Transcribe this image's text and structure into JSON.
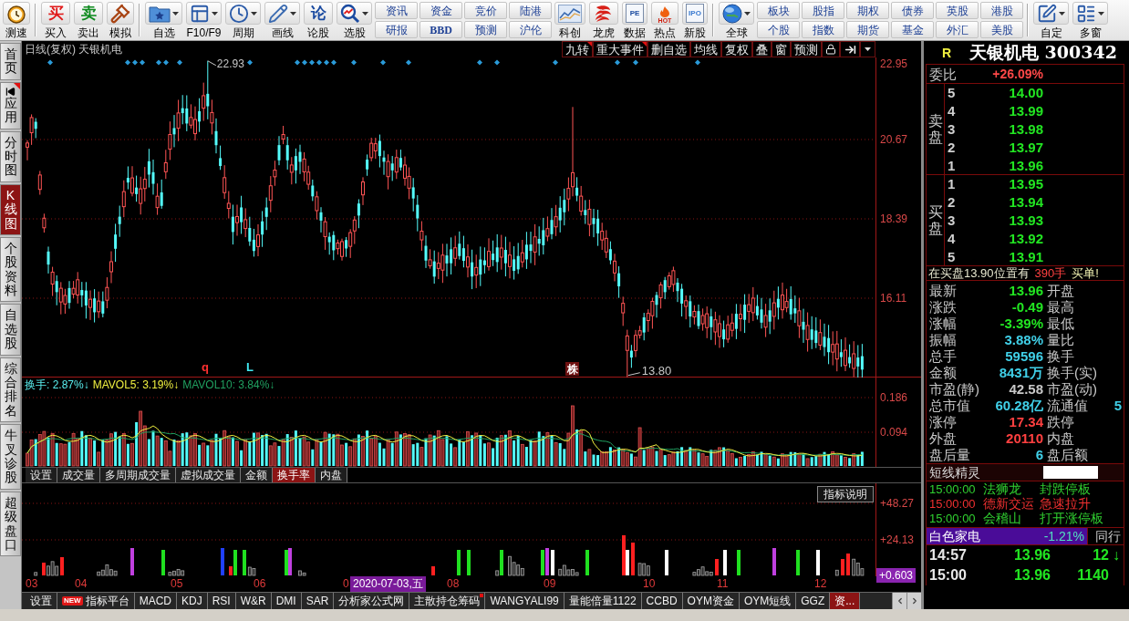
{
  "toolbar": [
    {
      "kind": "button",
      "label": "测速"
    },
    {
      "kind": "separator"
    },
    {
      "kind": "glyph",
      "label": "买入",
      "glyph": "买",
      "color": "#e01818"
    },
    {
      "kind": "glyph",
      "label": "卖出",
      "glyph": "卖",
      "color": "#0e8a1e"
    },
    {
      "kind": "button",
      "label": "模拟"
    },
    {
      "kind": "separator"
    },
    {
      "kind": "split",
      "label": "自选"
    },
    {
      "kind": "split",
      "label": "F10/F9"
    },
    {
      "kind": "split",
      "label": "周期"
    },
    {
      "kind": "split",
      "label": "画线"
    },
    {
      "kind": "glyph",
      "label": "论股",
      "glyph": "论",
      "color": "#1a4aa0"
    },
    {
      "kind": "split",
      "label": "选股"
    },
    {
      "kind": "pair",
      "buttons": [
        {
          "label": "资讯"
        },
        {
          "label": "研报"
        }
      ]
    },
    {
      "kind": "pair",
      "buttons": [
        {
          "label": "资金"
        },
        {
          "label": "BBD",
          "bold": true
        }
      ]
    },
    {
      "kind": "pair",
      "buttons": [
        {
          "label": "竞价"
        },
        {
          "label": "预测"
        }
      ]
    },
    {
      "kind": "pair",
      "buttons": [
        {
          "label": "陆港"
        },
        {
          "label": "沪伦"
        }
      ]
    },
    {
      "kind": "button",
      "label": "科创"
    },
    {
      "kind": "button",
      "label": "龙虎"
    },
    {
      "kind": "doc",
      "label": "数据",
      "glyph": "PE",
      "color": "#1a4aa0"
    },
    {
      "kind": "flame",
      "label": "热点",
      "glyph": "HOT",
      "color": "#d02010"
    },
    {
      "kind": "doc",
      "label": "新股",
      "glyph": "IPO",
      "color": "#3a7ad0"
    },
    {
      "kind": "separator"
    },
    {
      "kind": "split",
      "label": "全球"
    },
    {
      "kind": "pair",
      "buttons": [
        {
          "label": "板块"
        },
        {
          "label": "个股"
        }
      ]
    },
    {
      "kind": "pair",
      "buttons": [
        {
          "label": "股指"
        },
        {
          "label": "指数"
        }
      ]
    },
    {
      "kind": "pair",
      "buttons": [
        {
          "label": "期权"
        },
        {
          "label": "期货"
        }
      ]
    },
    {
      "kind": "pair",
      "buttons": [
        {
          "label": "债券"
        },
        {
          "label": "基金"
        }
      ]
    },
    {
      "kind": "pair",
      "buttons": [
        {
          "label": "英股"
        },
        {
          "label": "外汇"
        }
      ]
    },
    {
      "kind": "pair",
      "buttons": [
        {
          "label": "港股"
        },
        {
          "label": "美股"
        }
      ]
    },
    {
      "kind": "separator"
    },
    {
      "kind": "split",
      "label": "自定"
    },
    {
      "kind": "split",
      "label": "多窗"
    }
  ],
  "sidebar": [
    {
      "label": "首页",
      "kind": "tab",
      "selected": false
    },
    {
      "label": "应用",
      "kind": "menu",
      "selected": false
    },
    {
      "label": "分时图",
      "kind": "tab",
      "selected": false
    },
    {
      "label": "K线图",
      "kind": "tab",
      "selected": true
    },
    {
      "label": "个股资料",
      "kind": "tab",
      "selected": false
    },
    {
      "label": "自选股",
      "kind": "tab",
      "selected": false
    },
    {
      "label": "综合排名",
      "kind": "tab",
      "selected": false
    },
    {
      "label": "牛叉诊股",
      "kind": "tab",
      "selected": false
    },
    {
      "label": "超级盘口",
      "kind": "tab",
      "selected": false
    }
  ],
  "chart": {
    "title": "日线(复权) 天银机电",
    "tools": [
      {
        "label": "九转",
        "marked": true
      },
      {
        "label": "重大事件",
        "marked": true
      },
      {
        "label": "删自选",
        "marked": false
      },
      {
        "label": "均线",
        "marked": false
      },
      {
        "label": "复权",
        "marked": false
      },
      {
        "label": "叠",
        "marked": false
      },
      {
        "label": "窗",
        "marked": false
      },
      {
        "label": "预测",
        "marked": false
      }
    ],
    "price_axis": [
      "22.95",
      "20.67",
      "18.39",
      "16.11"
    ],
    "high_label": "22.93",
    "low_label": "13.80",
    "markers": [
      {
        "kind": "letter",
        "text": "q",
        "color": "#ff3030"
      },
      {
        "kind": "letter",
        "text": "L",
        "color": "#40e8f0"
      },
      {
        "kind": "badge",
        "text": "株",
        "color": "#6e1010"
      }
    ]
  },
  "volume": {
    "legend": [
      {
        "text": "换手: 2.87%↓",
        "color": "#5af0f0"
      },
      {
        "text": "MAVOL5: 3.19%↓",
        "color": "#f0f040"
      },
      {
        "text": "MAVOL10: 3.84%↓",
        "color": "#20a060"
      }
    ],
    "axis": [
      "0.186",
      "0.094"
    ]
  },
  "indicator_tabs": [
    {
      "label": "设置",
      "selected": false
    },
    {
      "label": "成交量",
      "selected": false
    },
    {
      "label": "多周期成交量",
      "selected": false
    },
    {
      "label": "虚拟成交量",
      "selected": false
    },
    {
      "label": "金额",
      "selected": false
    },
    {
      "label": "换手率",
      "selected": true
    },
    {
      "label": "内盘",
      "selected": false
    }
  ],
  "indicator": {
    "help": "指标说明",
    "axis": [
      {
        "text": "+48.27",
        "current": false
      },
      {
        "text": "+24.13",
        "current": false
      },
      {
        "text": "+0.603",
        "current": true
      }
    ]
  },
  "date_axis": {
    "months": [
      "03",
      "04",
      "05",
      "06",
      "0",
      "08",
      "09",
      "10",
      "11",
      "12"
    ],
    "cursor": "2020-07-03,五"
  },
  "bottom_tabs": [
    {
      "label": "设置",
      "selected": false,
      "marked": false
    },
    {
      "label": "指标平台",
      "badge": "NEW",
      "selected": false,
      "marked": false
    },
    {
      "label": "MACD",
      "selected": false,
      "marked": false
    },
    {
      "label": "KDJ",
      "selected": false,
      "marked": false
    },
    {
      "label": "RSI",
      "selected": false,
      "marked": false
    },
    {
      "label": "W&R",
      "selected": false,
      "marked": false
    },
    {
      "label": "DMI",
      "selected": false,
      "marked": false
    },
    {
      "label": "SAR",
      "selected": false,
      "marked": false
    },
    {
      "label": "分析家公式网",
      "selected": false,
      "marked": false
    },
    {
      "label": "主散持仓筹码",
      "selected": false,
      "marked": true
    },
    {
      "label": "WANGYALI99",
      "selected": false,
      "marked": false
    },
    {
      "label": "量能倍量1122",
      "selected": false,
      "marked": false
    },
    {
      "label": "CCBD",
      "selected": false,
      "marked": false
    },
    {
      "label": "OYM资金",
      "selected": false,
      "marked": false
    },
    {
      "label": "OYM短线",
      "selected": false,
      "marked": false
    },
    {
      "label": "GGZ",
      "selected": false,
      "marked": false
    },
    {
      "label": "资...",
      "selected": true,
      "marked": false
    }
  ],
  "quote": {
    "flag": "R",
    "title": "天银机电 300342",
    "ratio": {
      "label": "委比",
      "value": "+26.09%"
    },
    "sell_label": "卖盘",
    "sell": [
      {
        "rank": "5",
        "price": "14.00"
      },
      {
        "rank": "4",
        "price": "13.99"
      },
      {
        "rank": "3",
        "price": "13.98"
      },
      {
        "rank": "2",
        "price": "13.97"
      },
      {
        "rank": "1",
        "price": "13.96"
      }
    ],
    "buy_label": "买盘",
    "buy": [
      {
        "rank": "1",
        "price": "13.95"
      },
      {
        "rank": "2",
        "price": "13.94"
      },
      {
        "rank": "3",
        "price": "13.93"
      },
      {
        "rank": "4",
        "price": "13.92"
      },
      {
        "rank": "5",
        "price": "13.91"
      }
    ],
    "notice": {
      "text": "在买盘13.90位置有",
      "amount": "390手",
      "tail": "买单!"
    },
    "stats": [
      {
        "label": "最新",
        "value": "13.96",
        "color": "#22e622",
        "label2": "开盘"
      },
      {
        "label": "涨跌",
        "value": "-0.49",
        "color": "#22e622",
        "label2": "最高"
      },
      {
        "label": "涨幅",
        "value": "-3.39%",
        "color": "#22e622",
        "label2": "最低"
      },
      {
        "label": "振幅",
        "value": "3.88%",
        "color": "#40d0e8",
        "label2": "量比"
      },
      {
        "label": "总手",
        "value": "59596",
        "color": "#40d0e8",
        "label2": "换手"
      },
      {
        "label": "金额",
        "value": "8431万",
        "color": "#40d0e8",
        "label2": "换手(实)"
      },
      {
        "label": "市盈(静)",
        "value": "42.58",
        "color": "#c8c8c8",
        "label2": "市盈(动)"
      },
      {
        "label": "总市值",
        "value": "60.28亿",
        "color": "#40d0e8",
        "label2": "流通值",
        "value2": "5"
      },
      {
        "label": "涨停",
        "value": "17.34",
        "color": "#ff4040",
        "label2": "跌停"
      },
      {
        "label": "外盘",
        "value": "20110",
        "color": "#ff4040",
        "label2": "内盘"
      },
      {
        "label": "盘后量",
        "value": "6",
        "color": "#40d0e8",
        "label2": "盘后额"
      }
    ],
    "spirit": {
      "title": "短线精灵",
      "events": [
        {
          "time": "15:00:00",
          "stock": "法狮龙",
          "event": "封跌停板",
          "color": "#30d030"
        },
        {
          "time": "15:00:00",
          "stock": "德新交运",
          "event": "急速拉升",
          "color": "#f03030"
        },
        {
          "time": "15:00:00",
          "stock": "会稽山",
          "event": "打开涨停板",
          "color": "#30d030"
        }
      ]
    },
    "sector": {
      "name": "白色家电",
      "change": "-1.21%",
      "peer": "同行"
    },
    "ticks": [
      {
        "time": "14:57",
        "price": "13.96",
        "volume": "12",
        "arrow": "↓"
      },
      {
        "time": "15:00",
        "price": "13.96",
        "volume": "1140"
      }
    ]
  }
}
